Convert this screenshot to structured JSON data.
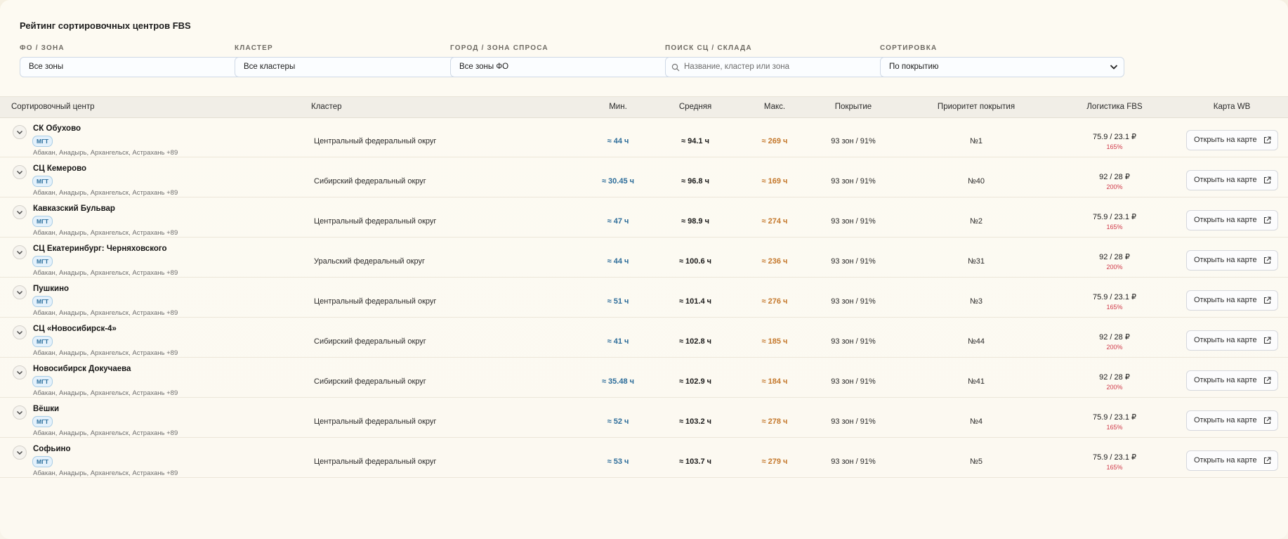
{
  "page": {
    "title": "Рейтинг сортировочных центров FBS"
  },
  "filters": [
    {
      "label": "ФО / ЗОНА",
      "value": "Все зоны",
      "type": "select"
    },
    {
      "label": "КЛАСТЕР",
      "value": "Все кластеры",
      "type": "select"
    },
    {
      "label": "ГОРОД / ЗОНА СПРОСА",
      "value": "Все зоны ФО",
      "type": "select"
    },
    {
      "label": "ПОИСК СЦ / СКЛАДА",
      "placeholder": "Название, кластер или зона",
      "type": "search"
    },
    {
      "label": "СОРТИРОВКА",
      "value": "По покрытию",
      "type": "select"
    }
  ],
  "table": {
    "headers": {
      "center": "Сортировочный центр",
      "cluster": "Кластер",
      "min": "Мин.",
      "avg": "Средняя",
      "max": "Макс.",
      "coverage": "Покрытие",
      "priority": "Приоритет покрытия",
      "logistics": "Логистика FBS",
      "map": "Карта WB"
    },
    "button_label": "Открыть на карте",
    "rows": [
      {
        "name": "СК Обухово",
        "badge": "МГТ",
        "regions": "Абакан, Анадырь, Архангельск, Астрахань +89",
        "cluster": "Центральный федеральный округ",
        "min": "≈ 44 ч",
        "avg": "≈ 94.1 ч",
        "max": "≈ 269 ч",
        "coverage": "93 зон / 91%",
        "priority": "№1",
        "logistics": "75.9 / 23.1 ₽",
        "logistics_pct": "165%"
      },
      {
        "name": "СЦ Кемерово",
        "badge": "МГТ",
        "regions": "Абакан, Анадырь, Архангельск, Астрахань +89",
        "cluster": "Сибирский федеральный округ",
        "min": "≈ 30.45 ч",
        "avg": "≈ 96.8 ч",
        "max": "≈ 169 ч",
        "coverage": "93 зон / 91%",
        "priority": "№40",
        "logistics": "92 / 28 ₽",
        "logistics_pct": "200%"
      },
      {
        "name": "Кавказский Бульвар",
        "badge": "МГТ",
        "regions": "Абакан, Анадырь, Архангельск, Астрахань +89",
        "cluster": "Центральный федеральный округ",
        "min": "≈ 47 ч",
        "avg": "≈ 98.9 ч",
        "max": "≈ 274 ч",
        "coverage": "93 зон / 91%",
        "priority": "№2",
        "logistics": "75.9 / 23.1 ₽",
        "logistics_pct": "165%"
      },
      {
        "name": "СЦ Екатеринбург: Черняховского",
        "badge": "МГТ",
        "regions": "Абакан, Анадырь, Архангельск, Астрахань +89",
        "cluster": "Уральский федеральный округ",
        "min": "≈ 44 ч",
        "avg": "≈ 100.6 ч",
        "max": "≈ 236 ч",
        "coverage": "93 зон / 91%",
        "priority": "№31",
        "logistics": "92 / 28 ₽",
        "logistics_pct": "200%"
      },
      {
        "name": "Пушкино",
        "badge": "МГТ",
        "regions": "Абакан, Анадырь, Архангельск, Астрахань +89",
        "cluster": "Центральный федеральный округ",
        "min": "≈ 51 ч",
        "avg": "≈ 101.4 ч",
        "max": "≈ 276 ч",
        "coverage": "93 зон / 91%",
        "priority": "№3",
        "logistics": "75.9 / 23.1 ₽",
        "logistics_pct": "165%"
      },
      {
        "name": "СЦ «Новосибирск-4»",
        "badge": "МГТ",
        "regions": "Абакан, Анадырь, Архангельск, Астрахань +89",
        "cluster": "Сибирский федеральный округ",
        "min": "≈ 41 ч",
        "avg": "≈ 102.8 ч",
        "max": "≈ 185 ч",
        "coverage": "93 зон / 91%",
        "priority": "№44",
        "logistics": "92 / 28 ₽",
        "logistics_pct": "200%"
      },
      {
        "name": "Новосибирск Докучаева",
        "badge": "МГТ",
        "regions": "Абакан, Анадырь, Архангельск, Астрахань +89",
        "cluster": "Сибирский федеральный округ",
        "min": "≈ 35.48 ч",
        "avg": "≈ 102.9 ч",
        "max": "≈ 184 ч",
        "coverage": "93 зон / 91%",
        "priority": "№41",
        "logistics": "92 / 28 ₽",
        "logistics_pct": "200%"
      },
      {
        "name": "Вёшки",
        "badge": "МГТ",
        "regions": "Абакан, Анадырь, Архангельск, Астрахань +89",
        "cluster": "Центральный федеральный округ",
        "min": "≈ 52 ч",
        "avg": "≈ 103.2 ч",
        "max": "≈ 278 ч",
        "coverage": "93 зон / 91%",
        "priority": "№4",
        "logistics": "75.9 / 23.1 ₽",
        "logistics_pct": "165%"
      },
      {
        "name": "Софьино",
        "badge": "МГТ",
        "regions": "Абакан, Анадырь, Архангельск, Астрахань +89",
        "cluster": "Центральный федеральный округ",
        "min": "≈ 53 ч",
        "avg": "≈ 103.7 ч",
        "max": "≈ 279 ч",
        "coverage": "93 зон / 91%",
        "priority": "№5",
        "logistics": "75.9 / 23.1 ₽",
        "logistics_pct": "165%"
      }
    ]
  },
  "icons": {
    "expand": "chevron-down-icon",
    "select": "chevron-down-icon",
    "search": "search-icon",
    "external": "external-link-icon"
  }
}
